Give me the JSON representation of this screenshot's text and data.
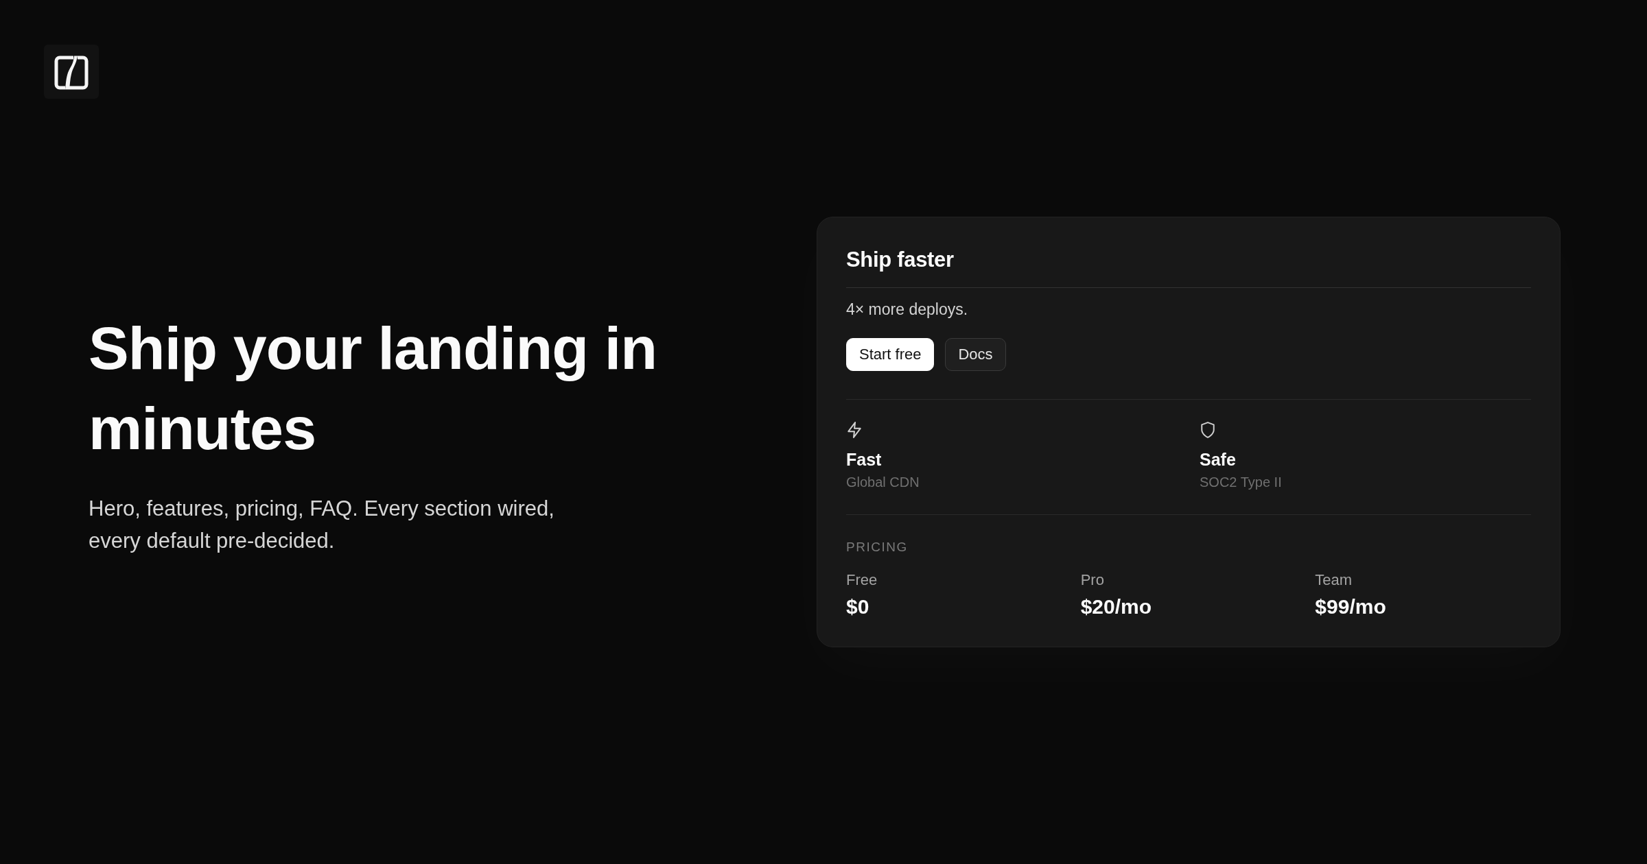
{
  "hero": {
    "title": "Ship your landing in minutes",
    "subtitle": "Hero, features, pricing, FAQ. Every section wired, every default pre-decided."
  },
  "card": {
    "title": "Ship faster",
    "tagline": "4× more deploys.",
    "buttons": [
      {
        "label": "Start free",
        "kind": "primary"
      },
      {
        "label": "Docs",
        "kind": "secondary"
      }
    ],
    "features": [
      {
        "title": "Fast",
        "detail": "Global CDN"
      },
      {
        "title": "Safe",
        "detail": "SOC2 Type II"
      }
    ],
    "pricing": {
      "label": "PRICING",
      "plans": [
        {
          "name": "Free",
          "price": "$0"
        },
        {
          "name": "Pro",
          "price": "$20/mo"
        },
        {
          "name": "Team",
          "price": "$99/mo"
        }
      ]
    }
  }
}
